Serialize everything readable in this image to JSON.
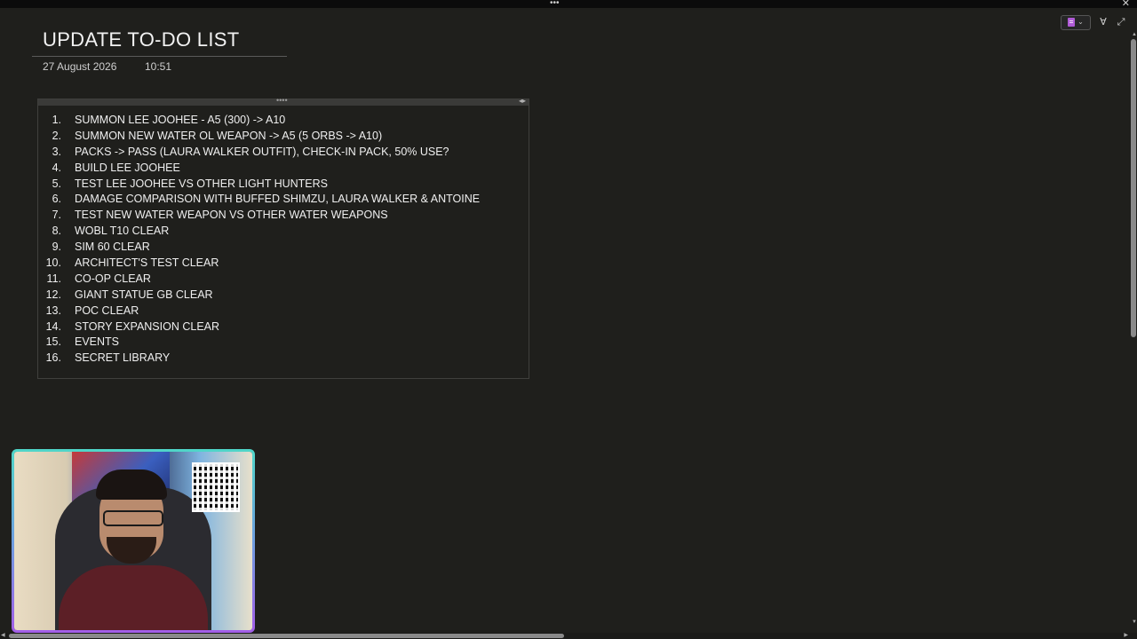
{
  "window": {
    "grip_glyph": "•••",
    "close_glyph": "✕"
  },
  "toolbar": {
    "notebook_icon": "notebook-icon",
    "chevron": "⌄",
    "pen_glyph": "∀",
    "expand_glyph": "⤢"
  },
  "page": {
    "title": "UPDATE TO-DO LIST",
    "date": "27 August 2026",
    "time": "10:51"
  },
  "note": {
    "items": [
      {
        "num": "1.",
        "text": "SUMMON LEE JOOHEE - A5 (300) -> A10"
      },
      {
        "num": "2.",
        "text": "SUMMON NEW WATER OL WEAPON -> A5 (5 ORBS -> A10)"
      },
      {
        "num": "3.",
        "text": "PACKS -> PASS (LAURA WALKER OUTFIT), CHECK-IN PACK, 50% USE?"
      },
      {
        "num": "4.",
        "text": "BUILD LEE JOOHEE"
      },
      {
        "num": "5.",
        "text": "TEST LEE JOOHEE VS OTHER LIGHT HUNTERS"
      },
      {
        "num": "6.",
        "text": "DAMAGE COMPARISON WITH BUFFED SHIMZU, LAURA WALKER & ANTOINE"
      },
      {
        "num": "7.",
        "text": "TEST NEW WATER WEAPON VS OTHER WATER WEAPONS"
      },
      {
        "num": "8.",
        "text": "WOBL T10 CLEAR"
      },
      {
        "num": "9.",
        "text": "SIM 60 CLEAR"
      },
      {
        "num": "10.",
        "text": "ARCHITECT'S TEST CLEAR"
      },
      {
        "num": "11.",
        "text": "CO-OP CLEAR"
      },
      {
        "num": "12.",
        "text": "GIANT STATUE GB CLEAR"
      },
      {
        "num": "13.",
        "text": "POC CLEAR"
      },
      {
        "num": "14.",
        "text": "STORY EXPANSION CLEAR"
      },
      {
        "num": "15.",
        "text": "EVENTS"
      },
      {
        "num": "16.",
        "text": "SECRET LIBRARY"
      }
    ]
  },
  "webcam": {
    "accent_top": "#4fd6c8",
    "accent_bottom": "#a35ee8"
  },
  "colors": {
    "background": "#1f1f1c",
    "notebook_accent": "#b05bd6"
  }
}
